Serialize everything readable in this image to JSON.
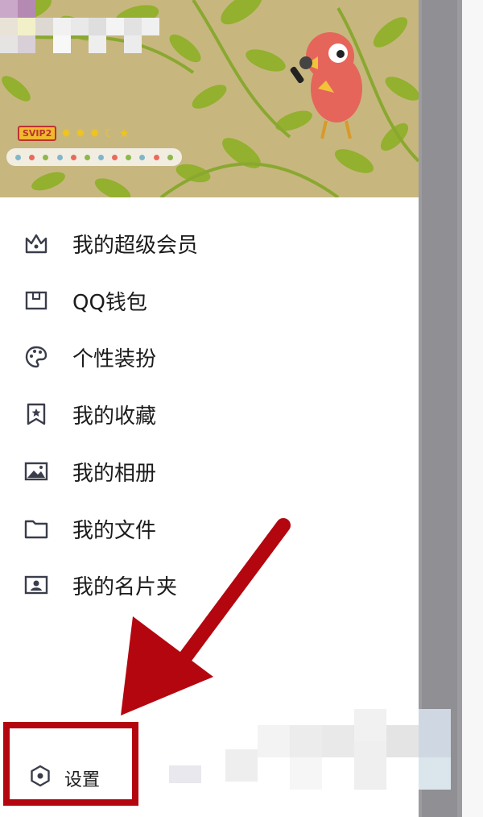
{
  "header": {
    "badge_svip": "SVIP2",
    "level_icons": [
      "sun-icon",
      "sun-icon",
      "sun-icon",
      "moon-icon",
      "star-icon"
    ]
  },
  "menu": {
    "items": [
      {
        "label": "我的超级会员",
        "icon": "crown-icon"
      },
      {
        "label": "QQ钱包",
        "icon": "wallet-icon"
      },
      {
        "label": "个性装扮",
        "icon": "palette-icon"
      },
      {
        "label": "我的收藏",
        "icon": "bookmark-star-icon"
      },
      {
        "label": "我的相册",
        "icon": "photo-icon"
      },
      {
        "label": "我的文件",
        "icon": "folder-icon"
      },
      {
        "label": "我的名片夹",
        "icon": "contact-card-icon"
      }
    ]
  },
  "footer": {
    "settings_label": "设置",
    "settings_icon": "hexagon-settings-icon"
  },
  "colors": {
    "header_bg": "#c7b77f",
    "leaf": "#8fae2f",
    "highlight_red": "#b4060f",
    "icon_stroke": "#3a3d4a"
  }
}
